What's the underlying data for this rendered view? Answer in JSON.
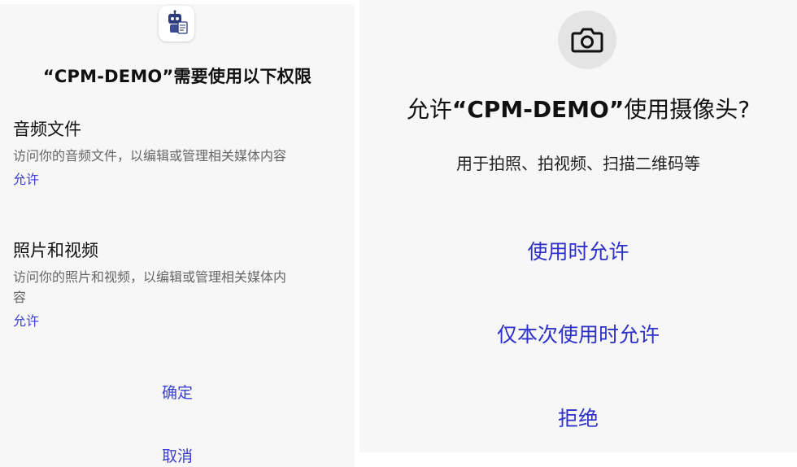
{
  "left": {
    "app_icon": "robot-app-icon",
    "title": "“CPM-DEMO”需要使用以下权限",
    "groups": [
      {
        "heading": "音频文件",
        "description": "访问你的音频文件，以编辑或管理相关媒体内容",
        "allow": "允许"
      },
      {
        "heading": "照片和视频",
        "description": "访问你的照片和视频，以编辑或管理相关媒体内容",
        "allow": "允许"
      }
    ],
    "confirm": "确定",
    "cancel": "取消"
  },
  "right": {
    "icon": "camera-icon",
    "title_prefix": "允许",
    "title_app": "“CPM-DEMO”",
    "title_suffix": "使用摄像头?",
    "subtitle": "用于拍照、拍视频、扫描二维码等",
    "options": {
      "while_using": "使用时允许",
      "only_this_time": "仅本次使用时允许",
      "deny": "拒绝"
    }
  },
  "colors": {
    "accent": "#2d31c8",
    "panel_bg": "#f7f7f7",
    "camera_circle": "#e4e4e4"
  }
}
